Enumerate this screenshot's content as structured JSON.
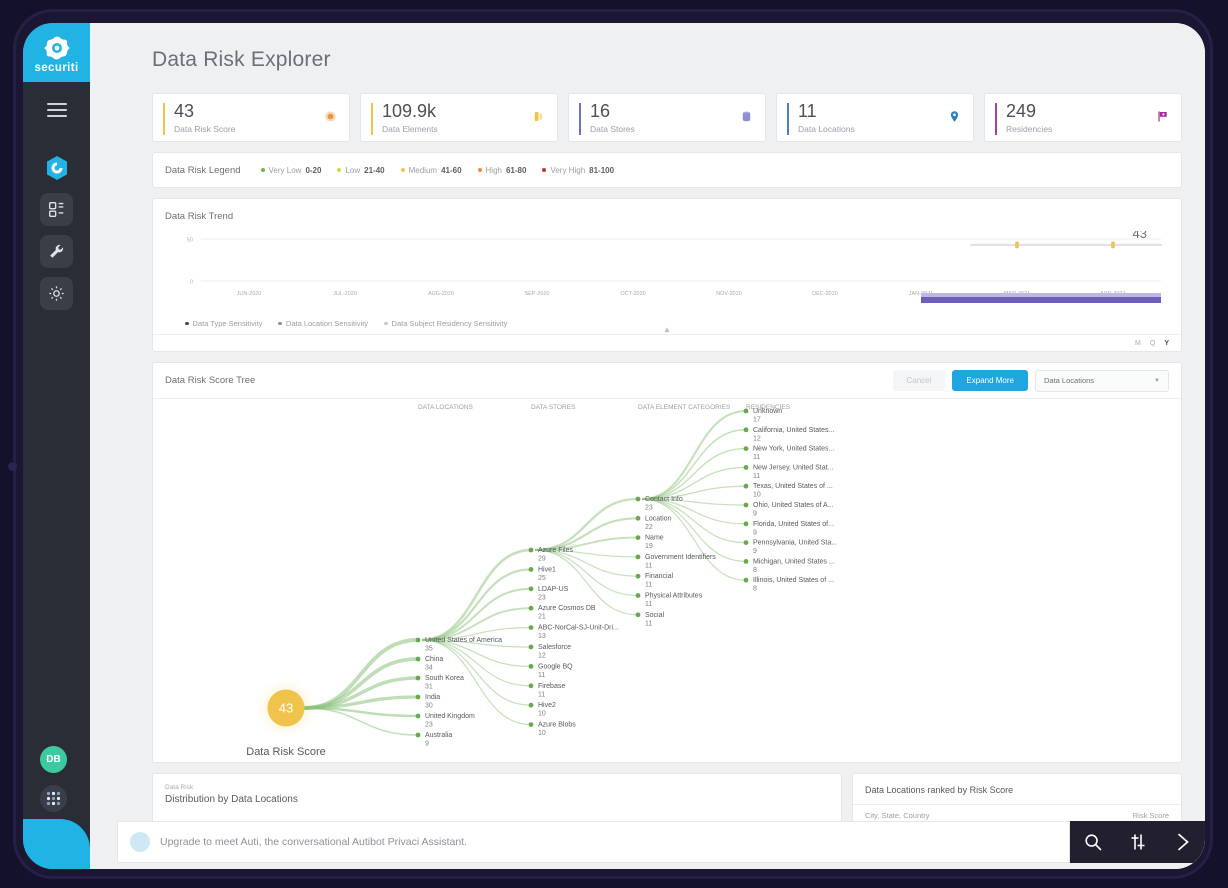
{
  "sidebar": {
    "brand": "securiti",
    "brand_icon": "securiti-logo-icon",
    "menu_icon": "hamburger-menu-icon",
    "nav": [
      {
        "icon": "hexagon-privaci-icon",
        "active": true
      },
      {
        "icon": "dashboard-grid-icon",
        "active": false
      },
      {
        "icon": "wrench-tools-icon",
        "active": false
      },
      {
        "icon": "gear-settings-icon",
        "active": false
      }
    ],
    "avatar_initials": "DB",
    "apps_icon": "app-grid-icon"
  },
  "header": {
    "title": "Data Risk Explorer"
  },
  "cards": [
    {
      "value": "43",
      "label": "Data Risk Score",
      "accent": "#f0c44a",
      "icon": "risk-dot-icon",
      "icon_color": "#e8963c"
    },
    {
      "value": "109.9k",
      "label": "Data Elements",
      "accent": "#f0c44a",
      "icon": "data-element-icon",
      "icon_color": "#f0c44a"
    },
    {
      "value": "16",
      "label": "Data Stores",
      "accent": "#6f6fc4",
      "icon": "database-icon",
      "icon_color": "#8f8fd6"
    },
    {
      "value": "11",
      "label": "Data Locations",
      "accent": "#4a7fc1",
      "icon": "map-pin-icon",
      "icon_color": "#2e7ec4"
    },
    {
      "value": "249",
      "label": "Residencies",
      "accent": "#a63fa6",
      "icon": "flag-icon",
      "icon_color": "#a0279e"
    }
  ],
  "legend": {
    "title": "Data Risk Legend",
    "items": [
      {
        "name": "Very Low",
        "range": "0-20",
        "color": "#7cb342"
      },
      {
        "name": "Low",
        "range": "21-40",
        "color": "#cddc39"
      },
      {
        "name": "Medium",
        "range": "41-60",
        "color": "#f0c44a"
      },
      {
        "name": "High",
        "range": "61-80",
        "color": "#ef8b3c"
      },
      {
        "name": "Very High",
        "range": "81-100",
        "color": "#c0392b"
      }
    ]
  },
  "trend": {
    "title": "Data Risk Trend",
    "legend": [
      {
        "label": "Data Type Sensitivity",
        "color": "#4c5058"
      },
      {
        "label": "Data Location Sensitivity",
        "color": "#8d9198"
      },
      {
        "label": "Data Subject Residency Sensitivity",
        "color": "#c8cbd0"
      }
    ],
    "periods": [
      {
        "label": "M",
        "active": false
      },
      {
        "label": "Q",
        "active": false
      },
      {
        "label": "Y",
        "active": true
      }
    ],
    "collapse_icon": "chevron-up-icon"
  },
  "chart_data": {
    "type": "line",
    "title": "Data Risk Trend",
    "xlabel": "",
    "ylabel": "",
    "ylim": [
      0,
      50
    ],
    "yticks": [
      0,
      50
    ],
    "ytick_labels": [
      "0",
      "50"
    ],
    "grid": true,
    "legend_position": "bottom-left",
    "categories": [
      "JUN-2020",
      "JUL-2020",
      "AUG-2020",
      "SEP-2020",
      "OCT-2020",
      "NOV-2020",
      "DEC-2020",
      "JAN-2021",
      "MAR-2021",
      "APR-2021"
    ],
    "series": [
      {
        "name": "Data Type Sensitivity",
        "color": "#f0c44a",
        "values": [
          null,
          null,
          null,
          null,
          null,
          null,
          null,
          null,
          43,
          43
        ]
      }
    ],
    "annotations": [
      {
        "text": "43",
        "x": "APR-2021",
        "y": 43,
        "position": "right"
      }
    ],
    "brush": {
      "color": "#6a5fbd",
      "track_color": "#bdb6e6",
      "from": "JAN-2021",
      "to": "APR-2021"
    }
  },
  "tree": {
    "title": "Data Risk Score Tree",
    "cancel_label": "Cancel",
    "expand_label": "Expand More",
    "filter_value": "Data Locations",
    "filter_caret_icon": "chevron-down-icon",
    "root": {
      "value": "43",
      "label": "Data Risk Score"
    },
    "columns": [
      {
        "header": "DATA LOCATIONS"
      },
      {
        "header": "DATA STORES"
      },
      {
        "header": "DATA ELEMENT CATEGORIES"
      },
      {
        "header": "RESIDENCIES"
      }
    ],
    "data_locations": [
      {
        "name": "United States of America",
        "value": "35"
      },
      {
        "name": "China",
        "value": "34"
      },
      {
        "name": "South Korea",
        "value": "31"
      },
      {
        "name": "India",
        "value": "30"
      },
      {
        "name": "United Kingdom",
        "value": "23"
      },
      {
        "name": "Australia",
        "value": "9"
      }
    ],
    "data_stores": [
      {
        "name": "Azure Files",
        "value": "29"
      },
      {
        "name": "Hive1",
        "value": "25"
      },
      {
        "name": "LDAP-US",
        "value": "23"
      },
      {
        "name": "Azure Cosmos DB",
        "value": "21"
      },
      {
        "name": "ABC-NorCal-SJ-Unit-Dri...",
        "value": "13"
      },
      {
        "name": "Salesforce",
        "value": "12"
      },
      {
        "name": "Google BQ",
        "value": "11"
      },
      {
        "name": "Firebase",
        "value": "11"
      },
      {
        "name": "Hive2",
        "value": "10"
      },
      {
        "name": "Azure Blobs",
        "value": "10"
      }
    ],
    "data_element_categories": [
      {
        "name": "Contact Info",
        "value": "23"
      },
      {
        "name": "Location",
        "value": "22"
      },
      {
        "name": "Name",
        "value": "19"
      },
      {
        "name": "Government Identifiers",
        "value": "11"
      },
      {
        "name": "Financial",
        "value": "11"
      },
      {
        "name": "Physical Attributes",
        "value": "11"
      },
      {
        "name": "Social",
        "value": "11"
      }
    ],
    "residencies": [
      {
        "name": "Unknown",
        "value": "17"
      },
      {
        "name": "California, United States...",
        "value": "12"
      },
      {
        "name": "New York, United States...",
        "value": "11"
      },
      {
        "name": "New Jersey, United Stat...",
        "value": "11"
      },
      {
        "name": "Texas, United States of ...",
        "value": "10"
      },
      {
        "name": "Ohio, United States of A...",
        "value": "9"
      },
      {
        "name": "Florida, United States of...",
        "value": "9"
      },
      {
        "name": "Pennsylvania, United Sta...",
        "value": "9"
      },
      {
        "name": "Michigan, United States ...",
        "value": "8"
      },
      {
        "name": "Illinois, United States of ...",
        "value": "8"
      }
    ]
  },
  "distribution": {
    "superscript": "Data Risk",
    "title": "Distribution by Data Locations"
  },
  "ranked": {
    "title": "Data Locations ranked by Risk Score",
    "col_location": "City, State, Country",
    "col_score": "Risk Score"
  },
  "chat": {
    "placeholder": "Upgrade to meet Auti, the conversational Autibot Privaci Assistant.",
    "avatar_icon": "user-bust-icon",
    "actions": [
      {
        "icon": "search-icon"
      },
      {
        "icon": "filter-sliders-icon"
      },
      {
        "icon": "send-arrow-icon"
      }
    ]
  }
}
